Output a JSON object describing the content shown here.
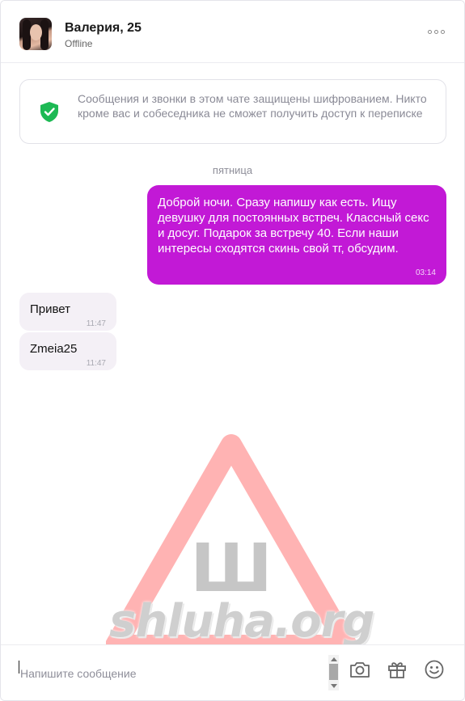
{
  "chat": {
    "contact_name": "Валерия, 25",
    "status": "Offline",
    "avatar_icon": "user-photo",
    "menu_icon": "more-dots-icon"
  },
  "encryption_notice": {
    "text": "Сообщения и звонки в этом чате защищены шифрованием. Никто кроме вас и собеседника не сможет получить доступ к переписке",
    "icon": "shield-check-icon",
    "icon_color": "#1db954"
  },
  "day_separator": "пятница",
  "messages": [
    {
      "direction": "outgoing",
      "text": "Доброй ночи. Сразу напишу как есть. Ищу девушку для постоянных встреч. Классный секс и досуг. Подарок за встречу 40. Если наши интересы сходятся скинь свой тг, обсудим.",
      "time": "03:14",
      "color": "#c219d6"
    },
    {
      "direction": "incoming",
      "text": "Привет",
      "time": "11:47"
    },
    {
      "direction": "incoming",
      "text": "Zmeia25",
      "time": "11:47"
    }
  ],
  "watermark": {
    "text": "shluha.org",
    "sign_letter": "Ш",
    "color": "#ff8080"
  },
  "composer": {
    "placeholder": "Напишите сообщение",
    "value": "",
    "icons": [
      "camera-icon",
      "gift-icon",
      "emoji-icon"
    ]
  }
}
